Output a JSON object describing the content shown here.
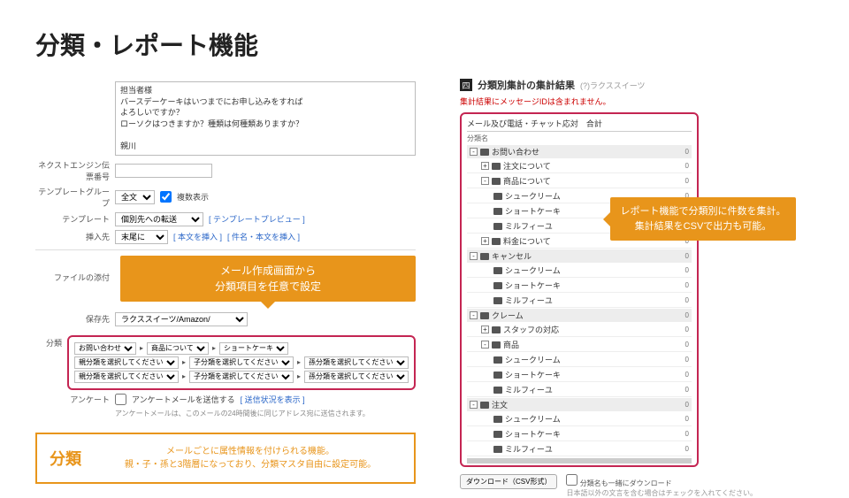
{
  "page_title": "分類・レポート機能",
  "left": {
    "body_label": "担当者様",
    "body_text": "バースデーケーキはいつまでにお申し込みをすれば\nよろしいですか？\nローソクはつきますか？種類は何種類ありますか？\n\n親川",
    "next_engine_label": "ネクストエンジン伝票番号",
    "tmpl_group_label": "テンプレートグループ",
    "tmpl_group_value": "全文",
    "tmpl_group_chk": "複数表示",
    "template_label": "テンプレート",
    "template_value": "個別先への転送",
    "template_preview_link": "[ テンプレートプレビュー ]",
    "insert_label": "挿入先",
    "insert_value": "末尾に",
    "insert_link1": "[ 本文を挿入 ]",
    "insert_link2": "[ 件名・本文を挿入 ]",
    "file_label": "ファイルの添付",
    "callout1_l1": "メール作成画面から",
    "callout1_l2": "分類項目を任意で設定",
    "savefirst_label": "保存先",
    "savefirst_value": "ラクススイーツ/Amazon/",
    "class_label": "分類",
    "c11": "お問い合わせ",
    "c12": "商品について",
    "c13": "ショートケーキ",
    "c21": "親分類を選択してください",
    "c22": "子分類を選択してください",
    "c23": "孫分類を選択してください",
    "c31": "親分類を選択してください",
    "c32": "子分類を選択してください",
    "c33": "孫分類を選択してください",
    "survey_label": "アンケート",
    "survey_chk": "アンケートメールを送信する",
    "survey_link": "[ 送信状況を表示 ]",
    "survey_note": "アンケートメールは、このメールの24時間後に同じアドレス宛に送信されます。",
    "gold_title": "分類",
    "gold_l1": "メールごとに属性情報を付けられる機能。",
    "gold_l2": "親・子・孫と3階層になっており、分類マスタ自由に設定可能。"
  },
  "right": {
    "rpt_title": "分類別集計の集計結果",
    "rpt_sub": "(?)ラクススイーツ",
    "rpt_warn": "集計結果にメッセージIDは含まれません。",
    "tabs_head": "メール及び電話・チャット応対　合計",
    "col_head": "分類名",
    "rows": [
      {
        "lvl": 0,
        "toggle": "-",
        "name": "お問い合わせ",
        "cnt": 0
      },
      {
        "lvl": 1,
        "toggle": "+",
        "name": "注文について",
        "cnt": 0
      },
      {
        "lvl": 1,
        "toggle": "-",
        "name": "商品について",
        "cnt": 0
      },
      {
        "lvl": 2,
        "name": "シュークリーム",
        "cnt": 0
      },
      {
        "lvl": 2,
        "name": "ショートケーキ",
        "cnt": 0
      },
      {
        "lvl": 2,
        "name": "ミルフィーユ",
        "cnt": 0
      },
      {
        "lvl": 1,
        "toggle": "+",
        "name": "料金について",
        "cnt": 0
      },
      {
        "lvl": 0,
        "toggle": "-",
        "name": "キャンセル",
        "cnt": 0
      },
      {
        "lvl": 2,
        "name": "シュークリーム",
        "cnt": 0
      },
      {
        "lvl": 2,
        "name": "ショートケーキ",
        "cnt": 0
      },
      {
        "lvl": 2,
        "name": "ミルフィーユ",
        "cnt": 0
      },
      {
        "lvl": 0,
        "toggle": "-",
        "name": "クレーム",
        "cnt": 0
      },
      {
        "lvl": 1,
        "toggle": "+",
        "name": "スタッフの対応",
        "cnt": 0
      },
      {
        "lvl": 1,
        "toggle": "-",
        "name": "商品",
        "cnt": 0
      },
      {
        "lvl": 2,
        "name": "シュークリーム",
        "cnt": 0
      },
      {
        "lvl": 2,
        "name": "ショートケーキ",
        "cnt": 0
      },
      {
        "lvl": 2,
        "name": "ミルフィーユ",
        "cnt": 0
      },
      {
        "lvl": 0,
        "toggle": "-",
        "name": "注文",
        "cnt": 0
      },
      {
        "lvl": 2,
        "name": "シュークリーム",
        "cnt": 0
      },
      {
        "lvl": 2,
        "name": "ショートケーキ",
        "cnt": 0
      },
      {
        "lvl": 2,
        "name": "ミルフィーユ",
        "cnt": 0
      }
    ],
    "dl_btn": "ダウンロード（CSV形式）",
    "dl_chk": "分類名も一緒にダウンロード",
    "dl_note": "日本語以外の文言を含む場合はチェックを入れてください。",
    "callout_l1": "レポート機能で分類別に件数を集計。",
    "callout_l2": "集計結果をCSVで出力も可能。"
  }
}
